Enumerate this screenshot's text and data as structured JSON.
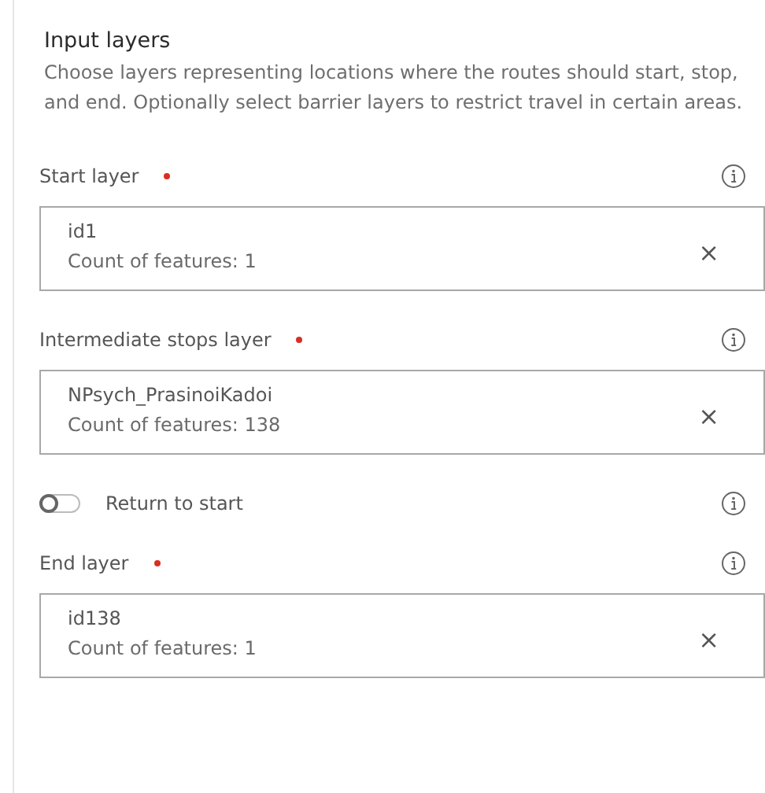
{
  "panel": {
    "title": "Input layers",
    "description": "Choose layers representing locations where the routes should start, stop, and end. Optionally select barrier layers to restrict travel in certain areas."
  },
  "fields": [
    {
      "kind": "layer",
      "label": "Start layer",
      "required": true,
      "value": "id1",
      "count": "Count of features: 1",
      "clear": "×"
    },
    {
      "kind": "layer",
      "label": "Intermediate stops layer",
      "required": true,
      "value": "NPsych_PrasinoiKadoi",
      "count": "Count of features: 138",
      "clear": "×"
    },
    {
      "kind": "toggle",
      "label": "Return to start",
      "on": false
    },
    {
      "kind": "layer",
      "label": "End layer",
      "required": true,
      "value": "id138",
      "count": "Count of features: 1",
      "clear": "×"
    }
  ]
}
